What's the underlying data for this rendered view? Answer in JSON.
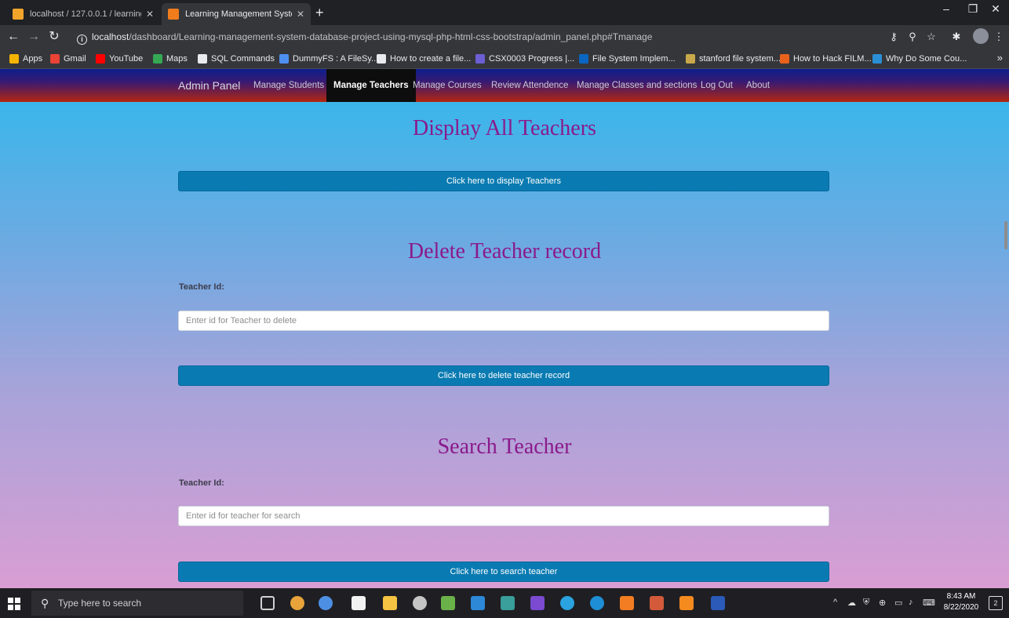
{
  "browser": {
    "tabs": [
      {
        "title": "localhost / 127.0.0.1 / learning m",
        "close": "✕",
        "icon": "phpmyadmin-icon"
      },
      {
        "title": "Learning Management System",
        "close": "✕",
        "icon": "xampp-icon"
      }
    ],
    "new_tab": "+",
    "window_controls": {
      "minimize": "–",
      "restore": "❐",
      "close": "✕"
    },
    "url_host": "localhost",
    "url_path": "/dashboard/Learning-management-system-database-project-using-mysql-php-html-css-bootstrap/admin_panel.php#Tmanage",
    "bookmarks": [
      {
        "label": "Apps",
        "color": "#f4b400"
      },
      {
        "label": "Gmail",
        "color": "#ea4335"
      },
      {
        "label": "YouTube",
        "color": "#ff0000"
      },
      {
        "label": "Maps",
        "color": "#34a853"
      },
      {
        "label": "SQL Commands",
        "color": "#e8eaed"
      },
      {
        "label": "DummyFS : A FileSy...",
        "color": "#4f8ff0"
      },
      {
        "label": "How to create a file...",
        "color": "#e8eaed"
      },
      {
        "label": "CSX0003 Progress |...",
        "color": "#6b5fd3"
      },
      {
        "label": "File System Implem...",
        "color": "#0a66c2"
      },
      {
        "label": "stanford file system...",
        "color": "#c8a84a"
      },
      {
        "label": "How to Hack FILM...",
        "color": "#e8621c"
      },
      {
        "label": "Why Do Some Cou...",
        "color": "#2b8fd6"
      }
    ],
    "bookmarks_more": "»"
  },
  "navbar": {
    "brand": "Admin Panel",
    "items": [
      "Manage Students",
      "Manage Teachers",
      "Manage Courses",
      "Review Attendence",
      "Manage Classes and sections",
      "Log Out",
      "About"
    ],
    "active_index": 1
  },
  "display_section": {
    "heading": "Display All Teachers",
    "button": "Click here to display Teachers"
  },
  "delete_section": {
    "heading": "Delete Teacher record",
    "label": "Teacher Id:",
    "placeholder": "Enter id for Teacher to delete",
    "button": "Click here to delete teacher record"
  },
  "search_section": {
    "heading": "Search Teacher",
    "label": "Teacher Id:",
    "placeholder": "Enter id for teacher for search",
    "button": "Click here to search teacher"
  },
  "taskbar": {
    "search_placeholder": "Type here to search",
    "time": "8:43 AM",
    "date": "8/22/2020",
    "notifications": "2",
    "colors": {
      "accent_brand": "#0a7bb2",
      "heading": "#8a1a8c"
    }
  }
}
